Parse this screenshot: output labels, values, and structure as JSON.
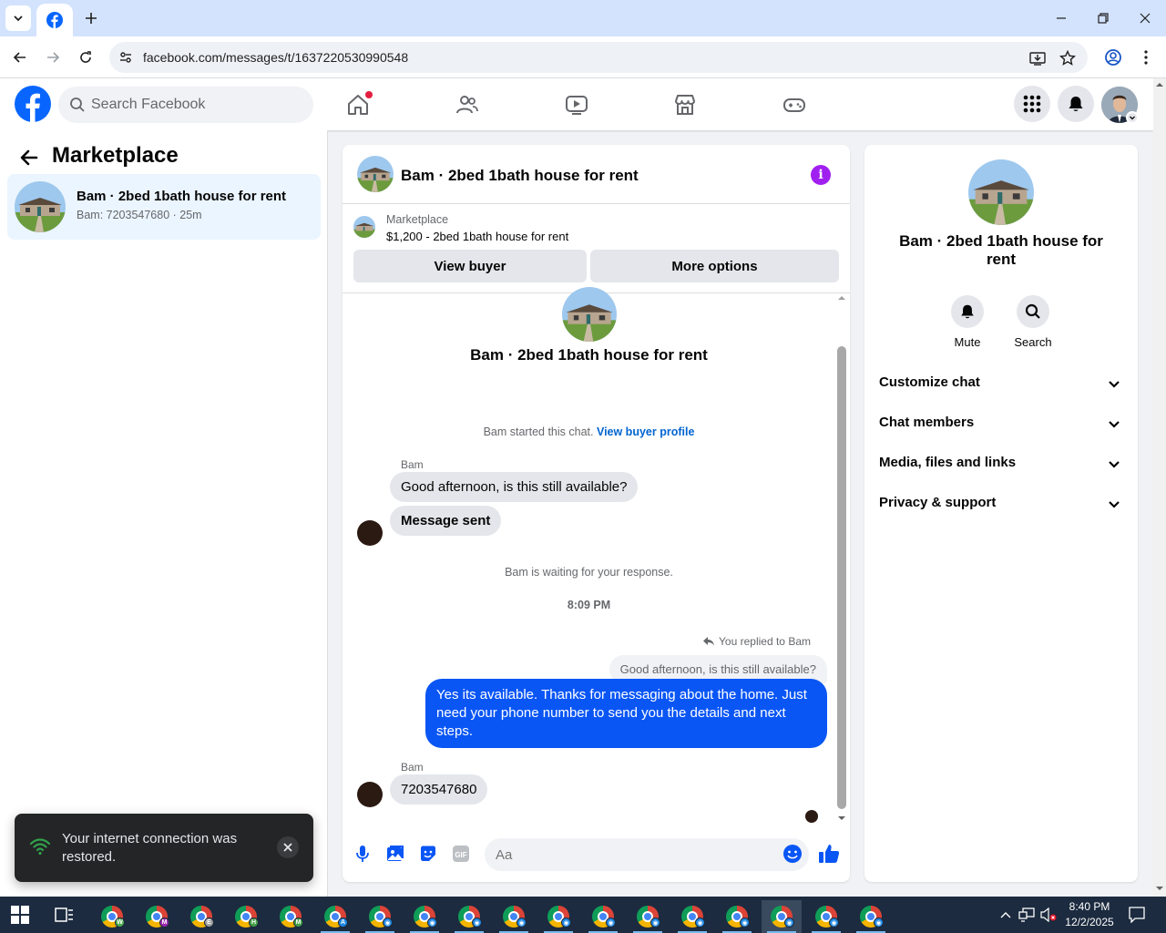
{
  "browser": {
    "url": "facebook.com/messages/t/1637220530990548"
  },
  "header": {
    "search_placeholder": "Search Facebook"
  },
  "left_panel": {
    "title": "Marketplace",
    "conversation": {
      "title": "Bam · 2bed 1bath house for rent",
      "subtitle": "Bam: 7203547680 · 25m"
    }
  },
  "chat": {
    "title": "Bam · 2bed 1bath house for rent",
    "listing": {
      "category": "Marketplace",
      "price_title": "$1,200 - 2bed 1bath house for rent"
    },
    "buttons": {
      "view_buyer": "View buyer",
      "more_options": "More options"
    },
    "intro_title": "Bam · 2bed 1bath house for rent",
    "started": {
      "text": "Bam started this chat.",
      "link": "View buyer profile"
    },
    "messages": {
      "sender1": "Bam",
      "msg1": "Good afternoon, is this still available?",
      "msg2": "Message sent",
      "waiting": "Bam is waiting for your response.",
      "time": "8:09 PM",
      "reply_tag": "You replied to Bam",
      "quoted": "Good afternoon, is this still available?",
      "out_msg": "Yes its available. Thanks for messaging about the home. Just need your phone number to send you the details and next steps.",
      "sender2": "Bam",
      "msg3": "7203547680"
    },
    "composer_placeholder": "Aa",
    "accent_color": "#0a56f5"
  },
  "right_panel": {
    "title": "Bam · 2bed 1bath house for rent",
    "mute": "Mute",
    "search": "Search",
    "sections": [
      "Customize chat",
      "Chat members",
      "Media, files and links",
      "Privacy & support"
    ]
  },
  "toast": {
    "text": "Your internet connection was restored."
  },
  "taskbar": {
    "time": "8:40 PM",
    "date": "12/2/2025"
  }
}
